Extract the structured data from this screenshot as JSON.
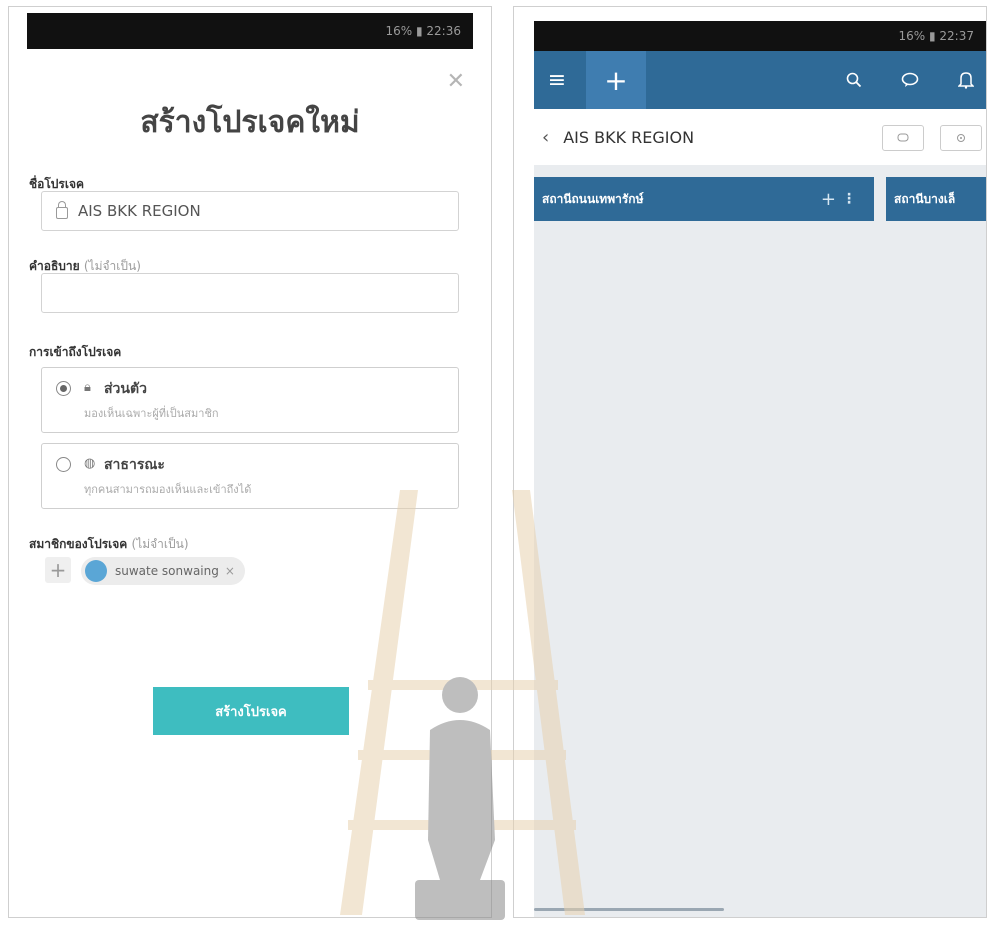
{
  "left_screen": {
    "status_bar": "16% ▮ 22:36",
    "close_icon": "✕",
    "title": "สร้างโปรเจคใหม่",
    "project_name": {
      "label": "ชื่อโปรเจค",
      "value": "AIS BKK REGION"
    },
    "description": {
      "label": "คำอธิบาย",
      "optional": "(ไม่จำเป็น)",
      "value": ""
    },
    "access": {
      "label": "การเข้าถึงโปรเจค",
      "options": [
        {
          "title": "ส่วนตัว",
          "desc": "มองเห็นเฉพาะผู้ที่เป็นสมาชิก",
          "selected": true,
          "icon": "lock-icon"
        },
        {
          "title": "สาธารณะ",
          "desc": "ทุกคนสามารถมองเห็นและเข้าถึงได้",
          "selected": false,
          "icon": "globe-icon"
        }
      ]
    },
    "members": {
      "label": "สมาชิกของโปรเจค",
      "optional": "(ไม่จำเป็น)",
      "add_symbol": "+",
      "chip_name": "suwate sonwaing",
      "chip_remove": "×"
    },
    "create_button": "สร้างโปรเจค",
    "accent_color": "#3ebdc0"
  },
  "right_screen": {
    "status_bar": "16% ▮ 22:37",
    "topbar_color": "#2f6a97",
    "menu_icon": "≡",
    "add_icon": "+",
    "search_icon": "⚲",
    "chat_icon": "💬",
    "bell_icon": "🔔",
    "back_icon": "‹",
    "project_title": "AIS BKK REGION",
    "lanes": [
      {
        "title": "สถานีถนนเทพารักษ์",
        "add": "+",
        "more": "⋮"
      },
      {
        "title": "สถานีบางเล็"
      }
    ]
  }
}
